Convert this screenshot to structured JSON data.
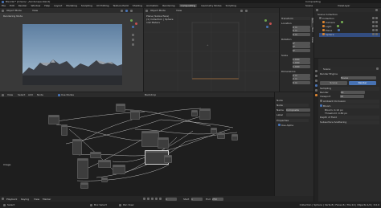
{
  "title_bar": {
    "title": "Blender* [/Users/.../landscape.blend]",
    "right_label": "Compositing"
  },
  "top_menu": {
    "items": [
      "File",
      "Edit",
      "Render",
      "Window",
      "Help",
      "Layout",
      "Modeling",
      "Sculpting",
      "UV Editing",
      "Texture Paint",
      "Shading",
      "Animation",
      "Rendering",
      "Compositing",
      "Geometry Nodes",
      "Scripting"
    ],
    "active": "Compositing",
    "scene_label": "Scene",
    "view_layer_label": "ViewLayer"
  },
  "viewport": {
    "header_label": "Object Mode",
    "view_label": "View",
    "overlay_text": "Rendering Node"
  },
  "image_editor": {
    "header_label": "Object Mode",
    "view_label": "View",
    "info_lines": [
      "Plane (Subsurface)",
      "(1) Collection | Sphere",
      "142 Meters"
    ],
    "cursor_label": "+"
  },
  "n_panel": {
    "title": "Transform",
    "sections": [
      {
        "label": "Location",
        "values": [
          "0 m",
          "0 m",
          "0 m"
        ]
      },
      {
        "label": "Rotation",
        "values": [
          "0°",
          "0°",
          "0°"
        ]
      },
      {
        "label": "Scale",
        "values": [
          "1.000",
          "1.000",
          "1.000"
        ]
      },
      {
        "label": "Dimensions",
        "values": [
          "2 m",
          "2 m",
          "0 m"
        ]
      }
    ],
    "tabs": [
      "Item",
      "Tool",
      "View"
    ]
  },
  "outliner": {
    "header": "Scene Collection",
    "items": [
      {
        "label": "Collection",
        "icon": "collection-icon",
        "color": "#bdbdbd"
      },
      {
        "label": "Camera",
        "icon": "camera-icon",
        "color": "#d8822f"
      },
      {
        "label": "Light",
        "icon": "light-icon",
        "color": "#d8822f"
      },
      {
        "label": "Plane",
        "icon": "mesh-icon",
        "color": "#d8822f"
      },
      {
        "label": "Sphere",
        "icon": "mesh-icon",
        "color": "#d8822f"
      }
    ]
  },
  "properties": {
    "header": "Scene",
    "rows": [
      {
        "label": "Render Engine",
        "value": "Eevee"
      },
      {
        "label": "Sampling",
        "value": ""
      },
      {
        "label": "Render",
        "value": "64"
      },
      {
        "label": "Viewport",
        "value": "16"
      },
      {
        "label": "Ambient Occlusion",
        "value": ""
      },
      {
        "label": "Bloom",
        "value": ""
      },
      {
        "label": "Depth of Field",
        "value": ""
      },
      {
        "label": "Subsurface Scattering",
        "value": ""
      }
    ],
    "button_left": "Scene",
    "button_right": "Render",
    "extra_lines": [
      "Bloom: 0.10 px",
      "Threshold: 0.80 px"
    ]
  },
  "node_editor": {
    "header_items": [
      "View",
      "Select",
      "Add",
      "Node"
    ],
    "checkbox_label": "Use Nodes",
    "backdrop_label": "Backdrop",
    "side_label": "Node",
    "bottom_label": "Image"
  },
  "node_sidebar": {
    "title": "Node",
    "name_label": "Name",
    "name_value": "Composite",
    "label_label": "Label",
    "properties_label": "Properties",
    "use_alpha_label": "Use Alpha"
  },
  "timeline": {
    "items": [
      "Playback",
      "Keying",
      "View",
      "Marker"
    ],
    "frame_value": "1",
    "start_label": "Start",
    "start_value": "1",
    "end_label": "End",
    "end_value": "250"
  },
  "status_bar": {
    "left": "Select",
    "middle_1": "Box Select",
    "middle_2": "Pan View",
    "right": "Collection | Sphere | Verts:8 | Faces:6 | Tris:12 | Objects:1/4 | 3.0.0"
  },
  "colors": {
    "accent": "#4772b3",
    "object_orange": "#d8822f",
    "sky_top": "#5d7ea0",
    "sky_bottom": "#a9c3d8",
    "mountain": "#3b3e45"
  }
}
